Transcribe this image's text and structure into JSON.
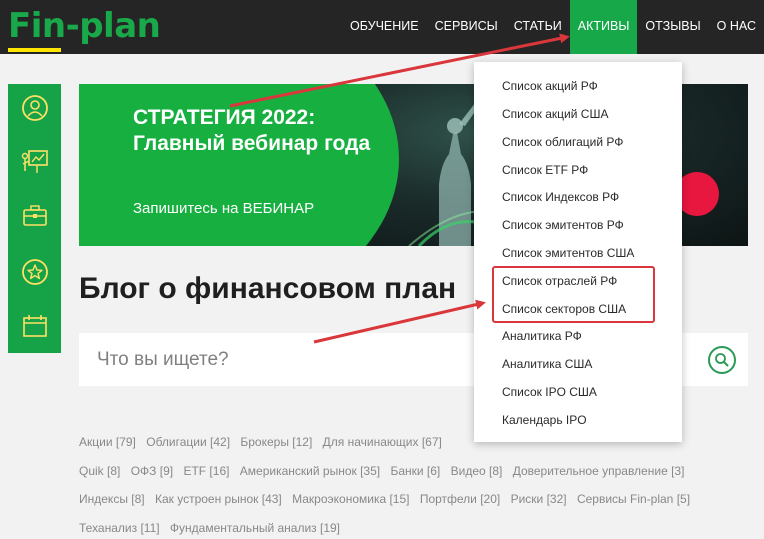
{
  "header": {
    "logo_text": "Fin-plan",
    "nav": [
      {
        "label": "ОБУЧЕНИЕ",
        "active": false
      },
      {
        "label": "СЕРВИСЫ",
        "active": false
      },
      {
        "label": "СТАТЬИ",
        "active": false
      },
      {
        "label": "АКТИВЫ",
        "active": true
      },
      {
        "label": "ОТЗЫВЫ",
        "active": false
      },
      {
        "label": "О НАС",
        "active": false
      }
    ]
  },
  "sidebar": {
    "icons": [
      "user-icon",
      "presentation-icon",
      "briefcase-icon",
      "star-icon",
      "calendar-icon"
    ]
  },
  "banner": {
    "title": "СТРАТЕГИЯ 2022: Главный вебинар года",
    "subtitle": "Запишитесь на ВЕБИНАР"
  },
  "blog": {
    "title": "Блог о финансовом план"
  },
  "search": {
    "placeholder": "Что вы ищете?"
  },
  "tags": [
    "Акции [79]",
    "Облигации [42]",
    "Брокеры [12]",
    "Для начинающих [67]",
    "Quik [8]",
    "ОФЗ [9]",
    "ETF [16]",
    "Американский рынок [35]",
    "Банки [6]",
    "Видео [8]",
    "Доверительное управление [3]",
    "Индексы [8]",
    "Как устроен рынок [43]",
    "Макроэкономика [15]",
    "Портфели [20]",
    "Риски [32]",
    "Сервисы Fin-plan [5]",
    "Теханализ [11]",
    "Фундаментальный анализ [19]"
  ],
  "dropdown": {
    "items": [
      "Список акций РФ",
      "Список акций США",
      "Список облигаций РФ",
      "Список ETF РФ",
      "Список Индексов РФ",
      "Список эмитентов РФ",
      "Список эмитентов США",
      "Список отраслей РФ",
      "Список секторов США",
      "Аналитика РФ",
      "Аналитика США",
      "Список IPO США",
      "Календарь IPO"
    ],
    "highlighted": [
      "Список отраслей РФ",
      "Список секторов США"
    ]
  },
  "colors": {
    "brand_green": "#17a84a",
    "header_bg": "#252525",
    "accent_yellow": "#ffe500",
    "annotation_red": "#d9373b"
  }
}
